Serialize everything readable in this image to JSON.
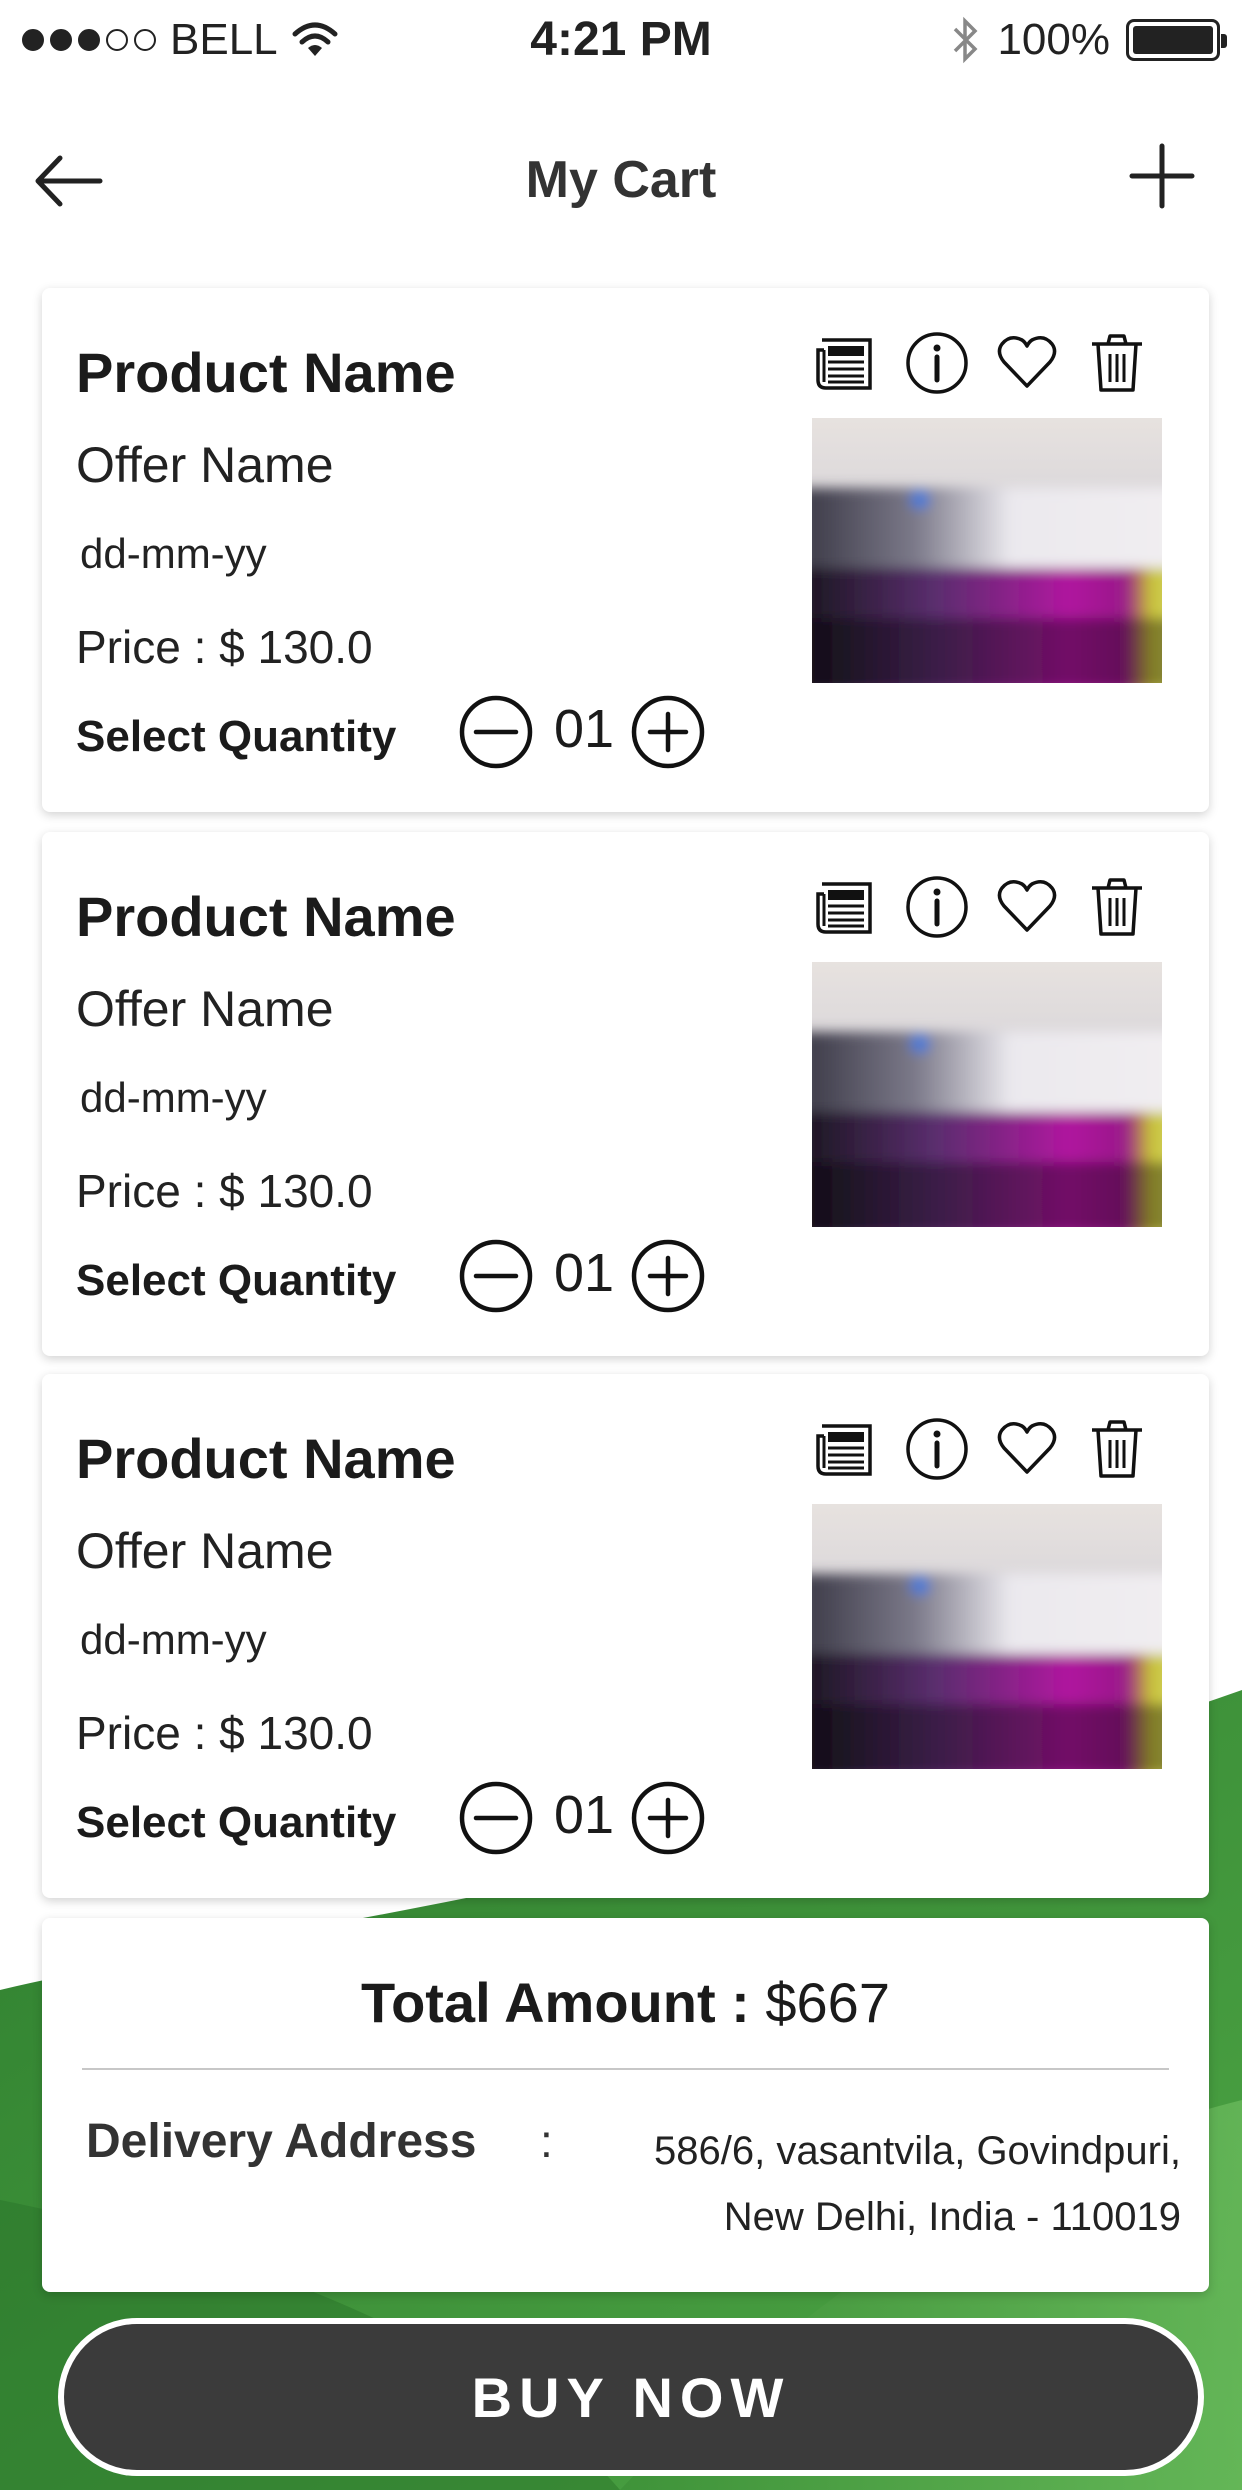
{
  "status_bar": {
    "carrier": "BELL",
    "time": "4:21 PM",
    "battery": "100%"
  },
  "header": {
    "title": "My Cart"
  },
  "cart_items": [
    {
      "product_name": "Product Name",
      "offer_name": "Offer Name",
      "date": "dd-mm-yy",
      "price": "Price : $ 130.0",
      "quantity_label": "Select Quantity",
      "quantity": "01"
    },
    {
      "product_name": "Product Name",
      "offer_name": "Offer Name",
      "date": "dd-mm-yy",
      "price": "Price : $ 130.0",
      "quantity_label": "Select Quantity",
      "quantity": "01"
    },
    {
      "product_name": "Product Name",
      "offer_name": "Offer Name",
      "date": "dd-mm-yy",
      "price": "Price : $ 130.0",
      "quantity_label": "Select Quantity",
      "quantity": "01"
    }
  ],
  "summary": {
    "total_label": "Total Amount :",
    "total_value": "$667",
    "address_label": "Delivery Address",
    "address_colon": ":",
    "address_line1": "586/6, vasantvila, Govindpuri,",
    "address_line2": "New Delhi, India - 110019"
  },
  "buy_button": {
    "label": "BUY NOW"
  },
  "colors": {
    "accent_green": "#3f9a3a",
    "button_dark": "#3b3b3b"
  },
  "icons": [
    "wifi-icon",
    "bluetooth-icon",
    "back-arrow-icon",
    "plus-icon",
    "receipt-icon",
    "info-icon",
    "heart-icon",
    "trash-icon",
    "minus-circle-icon",
    "plus-circle-icon"
  ]
}
